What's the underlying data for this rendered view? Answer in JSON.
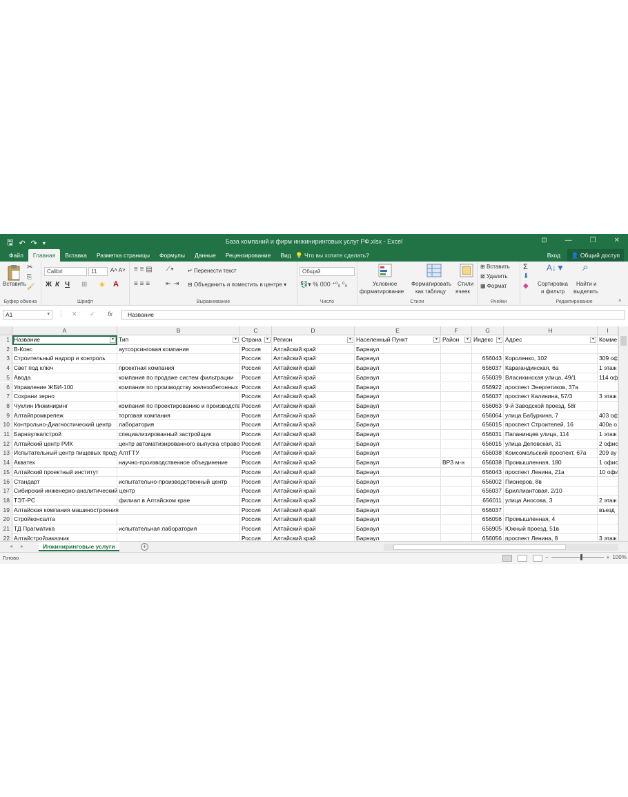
{
  "window": {
    "title": "База компаний и фирм инжиниринговых услуг РФ.xlsx - Excel"
  },
  "tabs": [
    "Файл",
    "Главная",
    "Вставка",
    "Разметка страницы",
    "Формулы",
    "Данные",
    "Рецензирование",
    "Вид"
  ],
  "tell_me": "Что вы хотите сделать?",
  "account": {
    "signin": "Вход",
    "share": "Общий доступ"
  },
  "ribbon": {
    "clipboard": {
      "paste": "Вставить",
      "label": "Буфер обмена"
    },
    "font": {
      "name": "Calibri",
      "size": "11",
      "label": "Шрифт",
      "bold": "Ж",
      "italic": "К",
      "underline": "Ч"
    },
    "alignment": {
      "wrap": "Перенести текст",
      "merge": "Объединить и поместить в центре",
      "label": "Выравнивание"
    },
    "number": {
      "format": "Общий",
      "label": "Число"
    },
    "styles": {
      "conditional_1": "Условное",
      "conditional_2": "форматирование",
      "table_1": "Форматировать",
      "table_2": "как таблицу",
      "cell_1": "Стили",
      "cell_2": "ячеек",
      "label": "Стили"
    },
    "cells": {
      "insert": "Вставить",
      "delete": "Удалить",
      "format": "Формат",
      "label": "Ячейки"
    },
    "editing": {
      "sort_1": "Сортировка",
      "sort_2": "и фильтр",
      "find_1": "Найти и",
      "find_2": "выделить",
      "label": "Редактирование"
    }
  },
  "formula_bar": {
    "cell_ref": "A1",
    "value": "Название",
    "fx": "fx"
  },
  "columns": [
    "A",
    "B",
    "C",
    "D",
    "E",
    "F",
    "G",
    "H",
    "I"
  ],
  "header": [
    "Название",
    "Тип",
    "Страна",
    "Регион",
    "Населенный Пункт",
    "Район",
    "Индекс",
    "Адрес",
    "Комме"
  ],
  "rows": [
    [
      "2",
      "В-Конс",
      "аутсорсинговая компания",
      "Россия",
      "Алтайский край",
      "Барнаул",
      "",
      "",
      "",
      ""
    ],
    [
      "3",
      "Строительный надзор и контроль",
      "",
      "Россия",
      "Алтайский край",
      "Барнаул",
      "",
      "656043",
      "Короленко, 102",
      "309 оф"
    ],
    [
      "4",
      "Свет под ключ",
      "проектная компания",
      "Россия",
      "Алтайский край",
      "Барнаул",
      "",
      "656037",
      "Карагандинская, 6а",
      "1 этаж"
    ],
    [
      "5",
      "Авода",
      "компания по продаже систем фильтрации",
      "Россия",
      "Алтайский край",
      "Барнаул",
      "",
      "656039",
      "Власихинская улица, 49/1",
      "114 оф"
    ],
    [
      "6",
      "Управление ЖБИ-100",
      "компания по производству железобетонных",
      "Россия",
      "Алтайский край",
      "Барнаул",
      "",
      "656922",
      "проспект Энергетиков, 37а",
      ""
    ],
    [
      "7",
      "Сохрани зерно",
      "",
      "Россия",
      "Алтайский край",
      "Барнаул",
      "",
      "656037",
      "проспект Калинина, 57/3",
      "3 этаж"
    ],
    [
      "8",
      "Чуклин Инжиниринг",
      "компания по проектированию и производству",
      "Россия",
      "Алтайский край",
      "Барнаул",
      "",
      "656063",
      "9-й Заводской проезд, 58г",
      ""
    ],
    [
      "9",
      "Алтайпромкрепеж",
      "торговая компания",
      "Россия",
      "Алтайский край",
      "Барнаул",
      "",
      "656064",
      "улица Бабуркина, 7",
      "403 оф"
    ],
    [
      "10",
      "Контрольно-Диагностический центр",
      "лаборатория",
      "Россия",
      "Алтайский край",
      "Барнаул",
      "",
      "656015",
      "проспект Строителей, 16",
      "400а о"
    ],
    [
      "11",
      "Барнаулкапстрой",
      "специализированный застройщик",
      "Россия",
      "Алтайский край",
      "Барнаул",
      "",
      "656031",
      "Папанинцев улица, 114",
      "1 этаж"
    ],
    [
      "12",
      "Алтайский центр РИК",
      "центр автоматизированного выпуска справок",
      "Россия",
      "Алтайский край",
      "Барнаул",
      "",
      "656015",
      "улица Деповская, 31",
      "2 офис"
    ],
    [
      "13",
      "Испытательный центр пищевых продуктов",
      "АлтГТУ",
      "Россия",
      "Алтайский край",
      "Барнаул",
      "",
      "656038",
      "Комсомольский проспект, 67а",
      "209 ау"
    ],
    [
      "14",
      "Акватех",
      "научно-производственное объединение",
      "Россия",
      "Алтайский край",
      "Барнаул",
      "ВРЗ м-н",
      "656038",
      "Промышленная, 180",
      "1 офис"
    ],
    [
      "15",
      "Алтайский проектный институт",
      "",
      "Россия",
      "Алтайский край",
      "Барнаул",
      "",
      "656043",
      "проспект Ленина, 21а",
      "10 офи"
    ],
    [
      "16",
      "Стандарт",
      "испытательно-производственный центр",
      "Россия",
      "Алтайский край",
      "Барнаул",
      "",
      "656002",
      "Пионеров, 8в",
      ""
    ],
    [
      "17",
      "Сибирский инженерно-аналитический центр",
      "",
      "Россия",
      "Алтайский край",
      "Барнаул",
      "",
      "656037",
      "Бриллиантовая, 2/10",
      ""
    ],
    [
      "18",
      "ТЭТ-РС",
      "филиал в Алтайском крае",
      "Россия",
      "Алтайский край",
      "Барнаул",
      "",
      "656011",
      "улица Аносова, 3",
      "2 этаж"
    ],
    [
      "19",
      "Алтайская компания машиностроения",
      "",
      "Россия",
      "Алтайский край",
      "Барнаул",
      "",
      "656037",
      "",
      "въезд"
    ],
    [
      "20",
      "Стройконсалта",
      "",
      "Россия",
      "Алтайский край",
      "Барнаул",
      "",
      "656056",
      "Промышленная, 4",
      ""
    ],
    [
      "21",
      "ТД Прагматика",
      "испытательная лаборатория",
      "Россия",
      "Алтайский край",
      "Барнаул",
      "",
      "656905",
      "Южный проезд, 51в",
      ""
    ],
    [
      "22",
      "Алтайстройзаказчик",
      "",
      "Россия",
      "Алтайский край",
      "Барнаул",
      "",
      "656056",
      "проспект Ленина, 8",
      "3 этаж"
    ]
  ],
  "sheet_tab": "Инжиниринговые услуги",
  "status": {
    "ready": "Готово",
    "zoom": "100%"
  },
  "colors": {
    "accent": "#217346"
  }
}
